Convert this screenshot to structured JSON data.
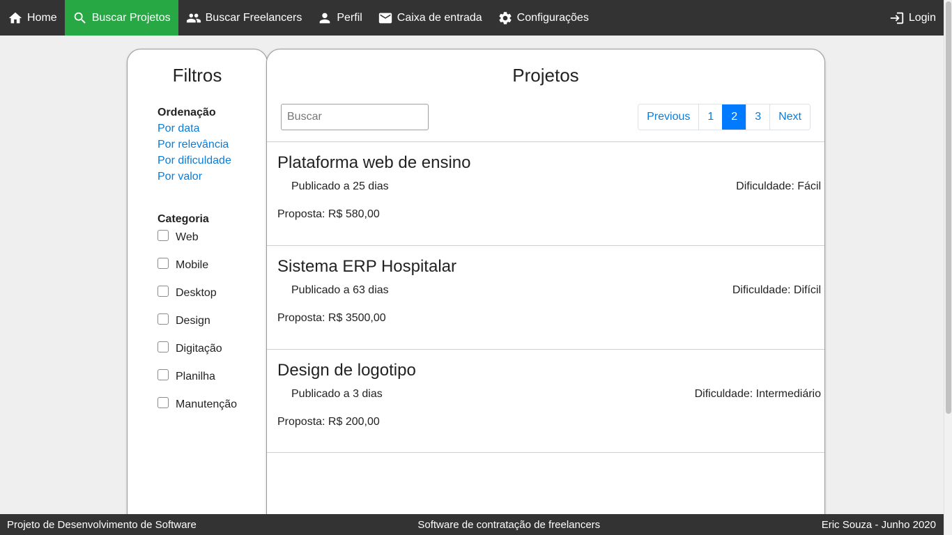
{
  "nav": {
    "items": [
      {
        "label": "Home",
        "icon": "home-icon"
      },
      {
        "label": "Buscar Projetos",
        "icon": "search-icon"
      },
      {
        "label": "Buscar Freelancers",
        "icon": "people-icon"
      },
      {
        "label": "Perfil",
        "icon": "person-icon"
      },
      {
        "label": "Caixa de entrada",
        "icon": "mail-icon"
      },
      {
        "label": "Configurações",
        "icon": "gear-icon"
      }
    ],
    "login": {
      "label": "Login",
      "icon": "login-icon"
    },
    "active_color": "#28a745",
    "bar_color": "#333333"
  },
  "filters": {
    "title": "Filtros",
    "sort_heading": "Ordenação",
    "sort_options": [
      "Por data",
      "Por relevância",
      "Por dificuldade",
      "Por valor"
    ],
    "category_heading": "Categoria",
    "categories": [
      "Web",
      "Mobile",
      "Desktop",
      "Design",
      "Digitação",
      "Planilha",
      "Manutenção"
    ]
  },
  "projects": {
    "title": "Projetos",
    "search_placeholder": "Buscar",
    "pagination": {
      "previous": "Previous",
      "pages": [
        "1",
        "2",
        "3"
      ],
      "current": "2",
      "next": "Next"
    },
    "items": [
      {
        "title": "Plataforma web de ensino",
        "published": "Publicado a 25 dias",
        "difficulty": "Dificuldade: Fácil",
        "proposal": "Proposta: R$ 580,00"
      },
      {
        "title": "Sistema ERP Hospitalar",
        "published": "Publicado a 63 dias",
        "difficulty": "Dificuldade: Difícil",
        "proposal": "Proposta: R$ 3500,00"
      },
      {
        "title": "Design de logotipo",
        "published": "Publicado a 3 dias",
        "difficulty": "Dificuldade: Intermediário",
        "proposal": "Proposta: R$ 200,00"
      }
    ]
  },
  "footer": {
    "left": "Projeto de Desenvolvimento de Software",
    "center": "Software de contratação de freelancers",
    "right": "Eric Souza - Junho 2020"
  }
}
